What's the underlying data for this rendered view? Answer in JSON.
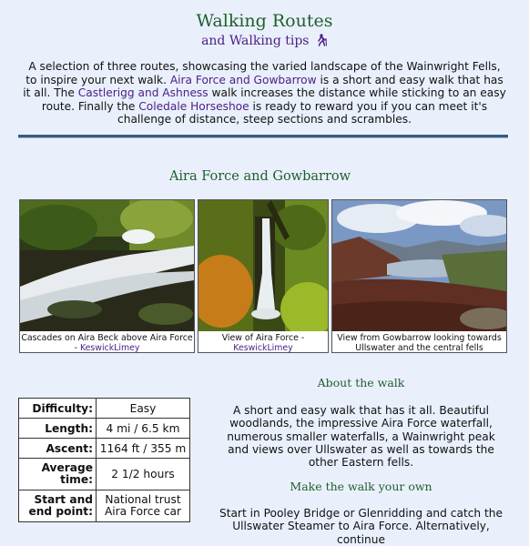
{
  "page": {
    "title": "Walking Routes",
    "subtitle": "and Walking tips",
    "subtitle_icon": "hiker-icon"
  },
  "intro": {
    "p1": "A selection of three routes, showcasing the varied landscape of the Wainwright Fells, to inspire your next walk. ",
    "link1": "Aira Force and Gowbarrow",
    "p2": " is a short and easy walk that has it all. The ",
    "link2": "Castlerigg and Ashness",
    "p3": " walk increases the distance while sticking to an easy route. Finally the ",
    "link3": "Coledale Horseshoe",
    "p4": " is ready to reward you if you can meet it's challenge of distance, steep sections and scrambles."
  },
  "section": {
    "title": "Aira Force and Gowbarrow",
    "photos": [
      {
        "caption": "Cascades on Aira Beck above Aira Force - ",
        "credit": "KeswickLimey",
        "icon": "river-cascade-photo"
      },
      {
        "caption": "View of Aira Force - ",
        "credit": "KeswickLimey",
        "icon": "waterfall-photo"
      },
      {
        "caption": "View from Gowbarrow looking towards Ullswater and the central fells",
        "credit": "",
        "icon": "lake-view-photo"
      }
    ],
    "stats": [
      {
        "label": "Difficulty:",
        "value": "Easy"
      },
      {
        "label": "Length:",
        "value": "4 mi / 6.5 km"
      },
      {
        "label": "Ascent:",
        "value": "1164 ft / 355 m"
      },
      {
        "label": "Average time:",
        "value": "2 1/2 hours"
      },
      {
        "label": "Start and end point:",
        "value": "National trust Aira Force car"
      }
    ],
    "about_heading": "About the walk",
    "about_text": "A short and easy walk that has it all. Beautiful woodlands, the impressive Aira Force waterfall, numerous smaller waterfalls, a Wainwright peak and views over Ullswater as well as towards the other Eastern fells.",
    "make_heading": "Make the walk your own",
    "make_text": "Start in Pooley Bridge or Glenridding and catch the Ullswater Steamer to Aira Force. Alternatively, continue"
  },
  "colors": {
    "background": "#e9f0fb",
    "heading_green": "#1f5e2c",
    "link_purple": "#4b1d86",
    "rule": "#3d5a7a"
  }
}
